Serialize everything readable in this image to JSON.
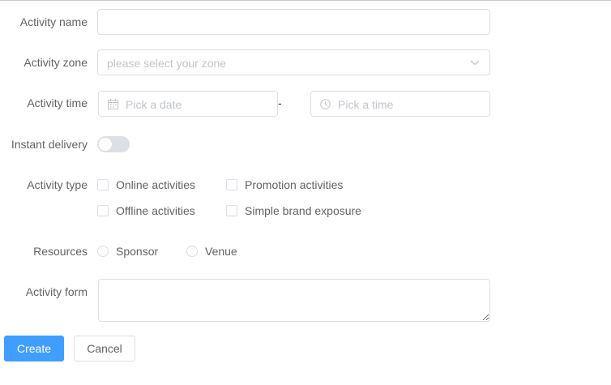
{
  "form": {
    "name": {
      "label": "Activity name",
      "value": ""
    },
    "zone": {
      "label": "Activity zone",
      "placeholder": "please select your zone"
    },
    "time": {
      "label": "Activity time",
      "date_placeholder": "Pick a date",
      "separator": "-",
      "time_placeholder": "Pick a time"
    },
    "delivery": {
      "label": "Instant delivery",
      "enabled": false
    },
    "type": {
      "label": "Activity type",
      "options": [
        {
          "label": "Online activities",
          "checked": false
        },
        {
          "label": "Promotion activities",
          "checked": false
        },
        {
          "label": "Offline activities",
          "checked": false
        },
        {
          "label": "Simple brand exposure",
          "checked": false
        }
      ]
    },
    "resources": {
      "label": "Resources",
      "options": [
        {
          "label": "Sponsor",
          "selected": false
        },
        {
          "label": "Venue",
          "selected": false
        }
      ]
    },
    "form_field": {
      "label": "Activity form",
      "value": ""
    }
  },
  "actions": {
    "create_label": "Create",
    "cancel_label": "Cancel"
  },
  "icons": {
    "zone_dropdown": "chevron-down-icon",
    "date": "calendar-icon",
    "time": "clock-icon"
  },
  "colors": {
    "primary": "#409eff",
    "border": "#dcdfe6",
    "placeholder": "#c0c4cc",
    "text": "#606266",
    "switch_off": "#dcdfe6"
  }
}
